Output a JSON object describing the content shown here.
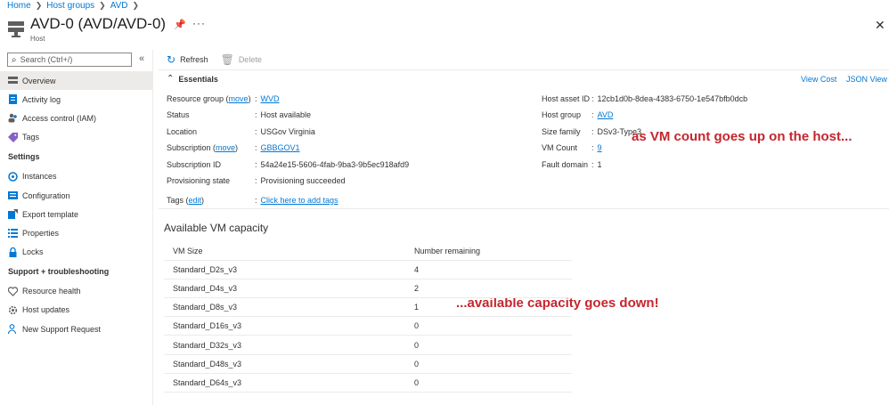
{
  "breadcrumb": [
    "Home",
    "Host groups",
    "AVD"
  ],
  "header": {
    "title": "AVD-0 (AVD/AVD-0)",
    "subtitle": "Host"
  },
  "sidebar": {
    "search_placeholder": "Search (Ctrl+/)",
    "top_items": [
      {
        "label": "Overview",
        "icon": "overview-icon",
        "active": true
      },
      {
        "label": "Activity log",
        "icon": "activity-log-icon"
      },
      {
        "label": "Access control (IAM)",
        "icon": "people-icon"
      },
      {
        "label": "Tags",
        "icon": "tag-icon"
      }
    ],
    "settings_header": "Settings",
    "settings_items": [
      {
        "label": "Instances",
        "icon": "instances-icon"
      },
      {
        "label": "Configuration",
        "icon": "configuration-icon"
      },
      {
        "label": "Export template",
        "icon": "export-template-icon"
      },
      {
        "label": "Properties",
        "icon": "properties-icon"
      },
      {
        "label": "Locks",
        "icon": "lock-icon"
      }
    ],
    "support_header": "Support + troubleshooting",
    "support_items": [
      {
        "label": "Resource health",
        "icon": "heart-icon"
      },
      {
        "label": "Host updates",
        "icon": "gear-icon"
      },
      {
        "label": "New Support Request",
        "icon": "person-help-icon"
      }
    ]
  },
  "toolbar": {
    "refresh_label": "Refresh",
    "delete_label": "Delete"
  },
  "essentials": {
    "title": "Essentials",
    "view_cost": "View Cost",
    "json_view": "JSON View",
    "left": {
      "resource_group_label": "Resource group",
      "resource_group_move": "move",
      "resource_group_value": "WVD",
      "status_label": "Status",
      "status_value": "Host available",
      "location_label": "Location",
      "location_value": "USGov Virginia",
      "subscription_label": "Subscription",
      "subscription_move": "move",
      "subscription_value": "GBBGOV1",
      "subscription_id_label": "Subscription ID",
      "subscription_id_value": "54a24e15-5606-4fab-9ba3-9b5ec918afd9",
      "provisioning_label": "Provisioning state",
      "provisioning_value": "Provisioning succeeded",
      "tags_label": "Tags",
      "tags_edit": "edit",
      "tags_value": "Click here to add tags"
    },
    "right": {
      "host_asset_id_label": "Host asset ID",
      "host_asset_id_value": "12cb1d0b-8dea-4383-6750-1e547bfb0dcb",
      "host_group_label": "Host group",
      "host_group_value": "AVD",
      "size_family_label": "Size family",
      "size_family_value": "DSv3-Type3",
      "vm_count_label": "VM Count",
      "vm_count_value": "9",
      "fault_domain_label": "Fault domain",
      "fault_domain_value": "1"
    }
  },
  "annotations": {
    "top": "as VM count goes up on the host...",
    "bottom": "...available capacity goes down!",
    "color": "#c4262e"
  },
  "capacity": {
    "title": "Available VM capacity",
    "columns": [
      "VM Size",
      "Number remaining"
    ],
    "rows": [
      [
        "Standard_D2s_v3",
        "4"
      ],
      [
        "Standard_D4s_v3",
        "2"
      ],
      [
        "Standard_D8s_v3",
        "1"
      ],
      [
        "Standard_D16s_v3",
        "0"
      ],
      [
        "Standard_D32s_v3",
        "0"
      ],
      [
        "Standard_D48s_v3",
        "0"
      ],
      [
        "Standard_D64s_v3",
        "0"
      ]
    ]
  }
}
